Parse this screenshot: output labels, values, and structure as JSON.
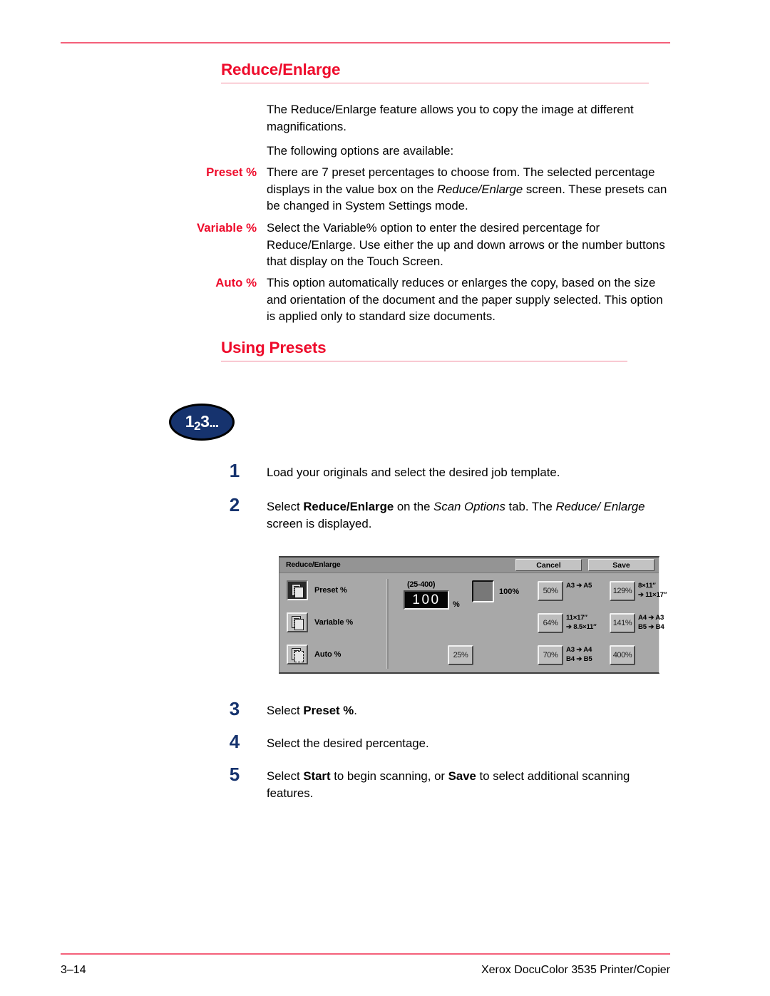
{
  "page": {
    "heading": "Reduce/Enlarge",
    "intro_1": "The Reduce/Enlarge feature allows you to copy the image at different magnifications.",
    "intro_2": "The following options are available:"
  },
  "options": [
    {
      "term": "Preset %",
      "text_a": "There are 7 preset percentages to choose from. The selected percentage displays in the value box on the ",
      "italic": "Reduce/Enlarge",
      "text_b": " screen.  These presets can be changed in System Settings mode."
    },
    {
      "term": "Variable %",
      "text_a": "Select the Variable% option to enter the desired percentage for Reduce/Enlarge. Use either the up and down arrows or the number buttons that display on the Touch Screen.",
      "italic": "",
      "text_b": ""
    },
    {
      "term": "Auto %",
      "text_a": "This option automatically reduces or enlarges the copy, based on the size and orientation of the document and the paper supply selected. This option is applied only to standard size documents.",
      "italic": "",
      "text_b": ""
    }
  ],
  "section2": {
    "heading": "Using Presets",
    "badge": {
      "lead": "1",
      "sub": "2",
      "tail": "3",
      "dots": "..."
    }
  },
  "steps": [
    {
      "num": "1",
      "parts": [
        {
          "t": "Load your originals and select the desired job template.",
          "s": "normal"
        }
      ]
    },
    {
      "num": "2",
      "parts": [
        {
          "t": "Select ",
          "s": "normal"
        },
        {
          "t": "Reduce/Enlarge",
          "s": "bold"
        },
        {
          "t": " on the ",
          "s": "normal"
        },
        {
          "t": "Scan Options",
          "s": "italic"
        },
        {
          "t": " tab. The ",
          "s": "normal"
        },
        {
          "t": "Reduce/ Enlarge",
          "s": "italic"
        },
        {
          "t": " screen is displayed.",
          "s": "normal"
        }
      ]
    },
    {
      "num": "3",
      "parts": [
        {
          "t": "Select ",
          "s": "normal"
        },
        {
          "t": "Preset %",
          "s": "bold"
        },
        {
          "t": ".",
          "s": "normal"
        }
      ]
    },
    {
      "num": "4",
      "parts": [
        {
          "t": "Select the desired percentage.",
          "s": "normal"
        }
      ]
    },
    {
      "num": "5",
      "parts": [
        {
          "t": "Select ",
          "s": "normal"
        },
        {
          "t": "Start",
          "s": "bold"
        },
        {
          "t": " to begin scanning, or ",
          "s": "normal"
        },
        {
          "t": "Save",
          "s": "bold"
        },
        {
          "t": " to select additional scanning features.",
          "s": "normal"
        }
      ]
    }
  ],
  "touch_panel": {
    "title": "Reduce/Enlarge",
    "cancel_label": "Cancel",
    "save_label": "Save",
    "modes": [
      {
        "label": "Preset %",
        "selected": true
      },
      {
        "label": "Variable %",
        "selected": false
      },
      {
        "label": "Auto %",
        "selected": false
      }
    ],
    "value_range": "(25-400)",
    "value": "100",
    "value_unit": "%",
    "swatch_label": "100%",
    "small_preset": {
      "label": "25%"
    },
    "presets": [
      {
        "label": "50%",
        "ratio_1": "A3 ➔ A5",
        "ratio_2": ""
      },
      {
        "label": "64%",
        "ratio_1": "11×17″",
        "ratio_2": "➔ 8.5×11″"
      },
      {
        "label": "70%",
        "ratio_1": "A3 ➔ A4",
        "ratio_2": "B4 ➔ B5"
      },
      {
        "label": "129%",
        "ratio_1": "8×11″",
        "ratio_2": "➔ 11×17″"
      },
      {
        "label": "141%",
        "ratio_1": "A4 ➔ A3",
        "ratio_2": "B5 ➔ B4"
      },
      {
        "label": "400%",
        "ratio_1": "",
        "ratio_2": ""
      }
    ]
  },
  "footer": {
    "page_number": "3–14",
    "product": "Xerox DocuColor 3535 Printer/Copier"
  },
  "colors": {
    "accent_red": "#ee0b2b",
    "rule_pink": "#f4607a",
    "step_navy": "#16336e",
    "panel_gray": "#a8a8a8"
  }
}
